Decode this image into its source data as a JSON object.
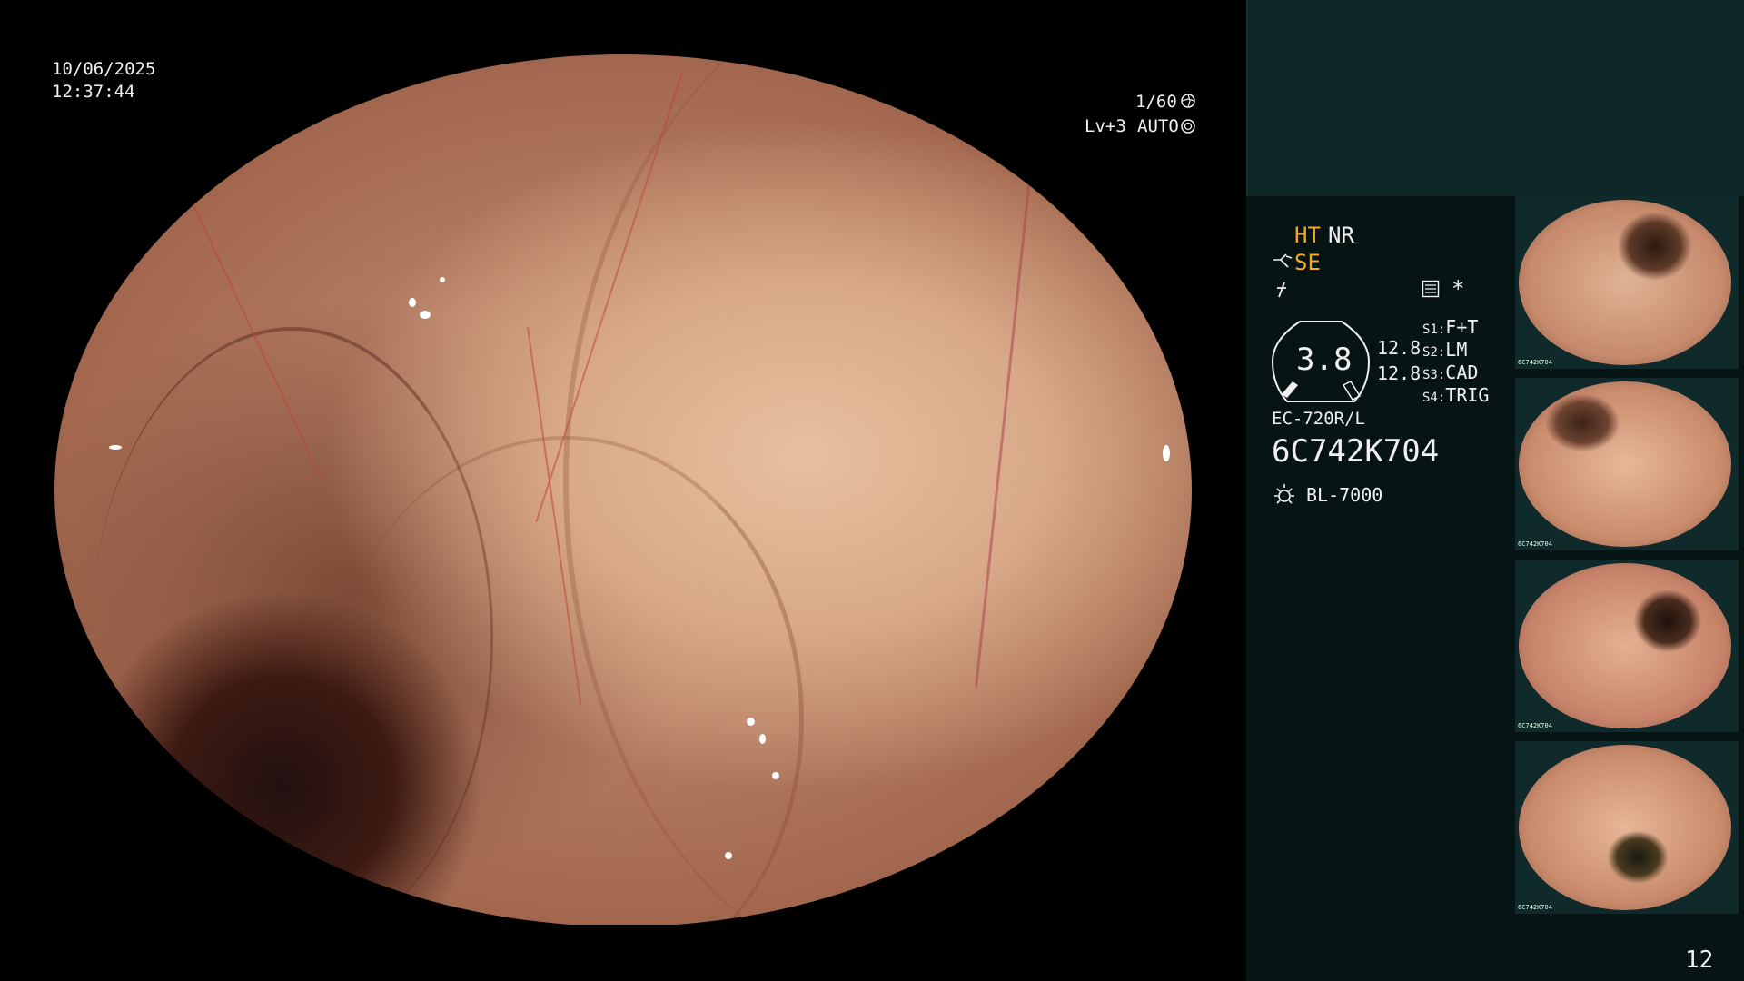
{
  "overlay": {
    "date": "10/06/2025",
    "time": "12:37:44",
    "shutter": "1/60",
    "level": "Lv+3",
    "iris_mode": "AUTO"
  },
  "panel": {
    "ht": "HT",
    "nr": "NR",
    "se": "SE",
    "meter_value": "3.8",
    "meter_right_1": "12.8",
    "meter_right_2": "12.8",
    "switches": [
      {
        "key": "S1:",
        "value": "F+T"
      },
      {
        "key": "S2:",
        "value": "LM"
      },
      {
        "key": "S3:",
        "value": "CAD"
      },
      {
        "key": "S4:",
        "value": "TRIG"
      }
    ],
    "scope_model": "EC-720R/L",
    "serial": "6C742K704",
    "light_source": "BL-7000",
    "page_number": "12",
    "accent_color": "#f5a623"
  },
  "thumbnails": [
    {
      "label": "6C742K704",
      "index": "1"
    },
    {
      "label": "6C742K704",
      "index": "2"
    },
    {
      "label": "6C742K704",
      "index": "3"
    },
    {
      "label": "6C742K704",
      "index": "4"
    }
  ]
}
